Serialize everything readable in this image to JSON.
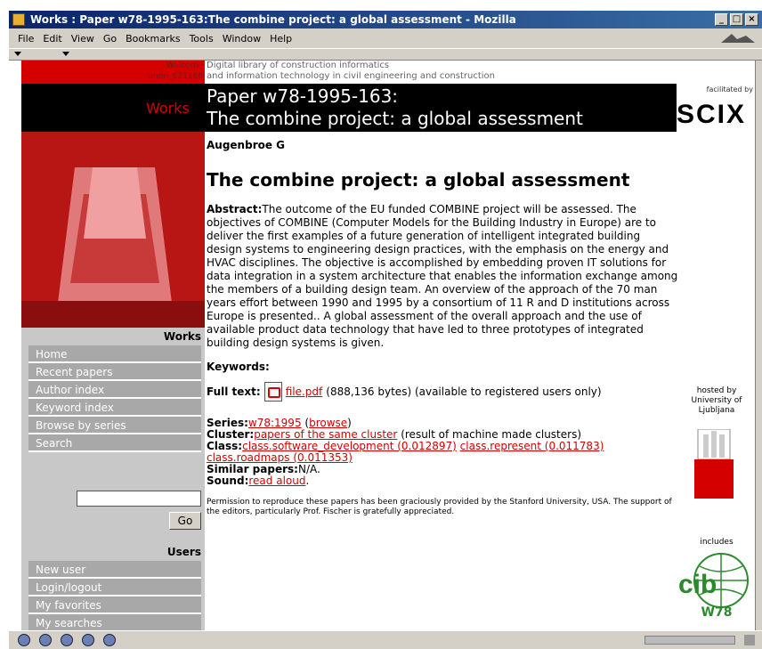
{
  "window": {
    "title": "Works : Paper w78-1995-163:The combine project: a global assessment - Mozilla",
    "controls": [
      "_",
      "□",
      "×"
    ]
  },
  "menu": [
    "File",
    "Edit",
    "View",
    "Go",
    "Bookmarks",
    "Tools",
    "Window",
    "Help"
  ],
  "site": {
    "welcome_line1": "Welcome",
    "welcome_line2": "anon_621166",
    "desc_line1": "Digital library of construction informatics",
    "desc_line2": "and information technology in civil engineering and construction",
    "logo_text": "Works",
    "facilitated_by": "facilitated by",
    "scix_logo": "SCIX"
  },
  "header": {
    "line1": "Paper w78-1995-163:",
    "line2": "The combine project: a global assessment"
  },
  "sidebar": {
    "works_heading": "Works",
    "works_items": [
      "Home",
      "Recent papers",
      "Author index",
      "Keyword index",
      "Browse by series",
      "Search"
    ],
    "search_value": "",
    "go_label": "Go",
    "users_heading": "Users",
    "users_items": [
      "New user",
      "Login/logout",
      "My favorites",
      "My searches"
    ]
  },
  "paper": {
    "author": "Augenbroe G",
    "title": "The combine project: a global assessment",
    "abstract_label": "Abstract:",
    "abstract_text": "The outcome of the EU funded COMBINE project will be assessed. The objectives of COMBINE (Computer Models for the Building Industry in Europe) are to deliver the first examples of a future generation of intelligent integrated building design systems to engineering design practices, with the emphasis on the energy and HVAC disciplines. The objective is accomplished by embedding proven IT solutions for data integration in a system architecture that enables the information exchange among the members of a building design team. An overview of the approach of the 70 man years effort between 1990 and 1995 by a consortium of 11 R and D institutions across Europe is presented.. A global assessment of the overall approach and the use of available product data technology that have led to three prototypes of integrated building design systems is given.",
    "keywords_label": "Keywords:",
    "fulltext_label": "Full text:",
    "file_link": "file.pdf",
    "file_info": "(888,136 bytes) (available to registered users only)",
    "series_label": "Series:",
    "series_link": "w78:1995",
    "browse_link": "browse",
    "cluster_label": "Cluster:",
    "cluster_link": "papers of the same cluster",
    "cluster_note": "(result of machine made clusters)",
    "class_label": "Class:",
    "class_links": [
      "class.software_development (0.012897)",
      "class.represent (0.011783)",
      "class.roadmaps (0.011353)"
    ],
    "similar_label": "Similar papers:",
    "similar_value": "N/A.",
    "sound_label": "Sound:",
    "sound_link": "read aloud",
    "permission": "Permission to reproduce these papers has been graciously provided by the Stanford University, USA. The support of the editors, particularly Prof. Fischer is gratefully appreciated."
  },
  "right": {
    "hosted_line1": "hosted by",
    "hosted_line2": "University of",
    "hosted_line3": "Ljubljana",
    "includes": "includes",
    "cib_logo": "cib",
    "w78_label": "W78"
  },
  "colors": {
    "accent_red": "#d40000",
    "sidebar_gray": "#a8a8a8",
    "title_bar": "#0a246a"
  }
}
